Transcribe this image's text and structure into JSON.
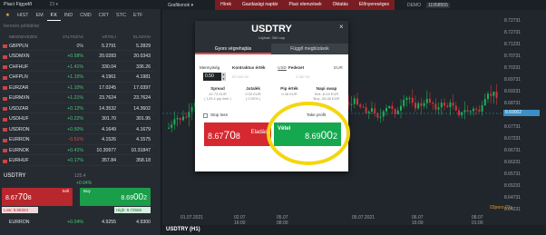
{
  "watchlist": {
    "title": "Piaci Figyelő",
    "count": "23 ▾",
    "tabs": [
      "★",
      "HIST",
      "EM",
      "FX",
      "IND",
      "CMD",
      "CRT",
      "STC",
      "ETF"
    ],
    "search_placeholder": "keresés példáklat",
    "columns": [
      "MEGNEVEZÉS",
      "VÁLTOZÁS",
      "VÉTELI",
      "ELADÁSI"
    ],
    "rows": [
      {
        "name": "GBPPLN",
        "chg": "0%",
        "bid": "5.2791",
        "ask": "5.2829",
        "dir": "none"
      },
      {
        "name": "USDMXN",
        "chg": "+0.58%",
        "bid": "20.0283",
        "ask": "20.0343",
        "dir": "pos"
      },
      {
        "name": "CHFHUF",
        "chg": "+1.41%",
        "bid": "330.04",
        "ask": "336.26",
        "dir": "pos"
      },
      {
        "name": "CHFPLN",
        "chg": "+1.15%",
        "bid": "4.1961",
        "ask": "4.1981",
        "dir": "pos"
      },
      {
        "name": "EURZAR",
        "chg": "+1.10%",
        "bid": "17.0245",
        "ask": "17.0397",
        "dir": "pos"
      },
      {
        "name": "EURMXN",
        "chg": "+1.21%",
        "bid": "23.7624",
        "ask": "23.7624",
        "dir": "pos"
      },
      {
        "name": "USDZAR",
        "chg": "+0.12%",
        "bid": "14.3532",
        "ask": "14.3602",
        "dir": "pos"
      },
      {
        "name": "USDHUF",
        "chg": "+0.22%",
        "bid": "301.70",
        "ask": "301.95",
        "dir": "pos"
      },
      {
        "name": "USDRON",
        "chg": "+0.50%",
        "bid": "4.1649",
        "ask": "4.1679",
        "dir": "pos"
      },
      {
        "name": "EURRON",
        "chg": "-0.51%",
        "bid": "4.1526",
        "ask": "4.1575",
        "dir": "neg"
      },
      {
        "name": "EURNOK",
        "chg": "+0.41%",
        "bid": "10.30977",
        "ask": "10.31847",
        "dir": "pos"
      },
      {
        "name": "EURHUF",
        "chg": "+0.17%",
        "bid": "357.84",
        "ask": "358.18",
        "dir": "pos"
      }
    ],
    "bottom_row": {
      "name": "EURRON",
      "chg": "+0.04%",
      "bid": "4.9255",
      "ask": "4.9300"
    }
  },
  "ticket": {
    "symbol": "USDTRY",
    "sub": "125.4",
    "pct": "+0.64%",
    "sell_label": "Sell",
    "buy_label": "Buy",
    "sell_price_main": "8.67",
    "sell_price_big": "70",
    "sell_price_end": "8",
    "buy_price_main": "8.69",
    "buy_price_big": "00",
    "buy_price_end": "2",
    "low": "Low: 8.66324",
    "high": "High: 8.72566"
  },
  "topbar": {
    "tabs": [
      "Grafikonok ▾",
      "Hírek",
      "Gazdasági naptár",
      "Piaci elemzések",
      "Oktatás",
      "Előnyereséges"
    ],
    "account": "DEMO",
    "balance": "11958555"
  },
  "chart": {
    "title": "USDTRY (H1)",
    "y_labels": [
      "8.72731",
      "8.72731",
      "8.71231",
      "8.70731",
      "8.70231",
      "8.69731",
      "8.69231",
      "8.68731",
      "8.68231",
      "8.67731",
      "8.67231",
      "8.66731",
      "8.66231",
      "8.65731",
      "8.65231",
      "8.64731",
      "8.64231"
    ],
    "x_labels": [
      "01.07.2021",
      "02.07 16:00",
      "05.07 08:00",
      "05.07.2021",
      "06.07 16:00",
      "08.07 01:00"
    ],
    "price_tag": "8.69002",
    "watermark": "03pero 01s"
  },
  "modal": {
    "title": "USDTRY",
    "subtitle": "Lejárat: 360 nap",
    "tabs": [
      "Gyors végrehajtás",
      "Függő megbízások"
    ],
    "qty_label": "Mennyiség",
    "qty_value": "0.50",
    "contract_label": "Kontraktus érték",
    "contract_ccy": "USD",
    "contract_value": "50 000.00",
    "margin_label": "Fedezet",
    "margin_ccy": "EUR",
    "margin_value": "2 087.94",
    "spread_label": "Spread",
    "spread_val": "42.73 EUR",
    "spread_sub": "( 129.4 pip limit )",
    "jutalek_label": "Jutalék",
    "jutalek_val": "0.00 EUR",
    "jutalek_sub": "( 0.00% )",
    "pip_label": "Pip érték",
    "pip_val": "0.46 EUR",
    "swap_label": "Napi swap",
    "swap_sell": "Sell -8.03 EUR",
    "swap_buy": "Buy -28.48 EUR",
    "stop_loss": "Stop loss",
    "take_profit": "Take profit",
    "sell_label": "Eladás",
    "sell_main": "8.67",
    "sell_big": "70",
    "sell_end": "8",
    "buy_label": "Vétel",
    "buy_main": "8.69",
    "buy_big": "00",
    "buy_end": "2"
  }
}
